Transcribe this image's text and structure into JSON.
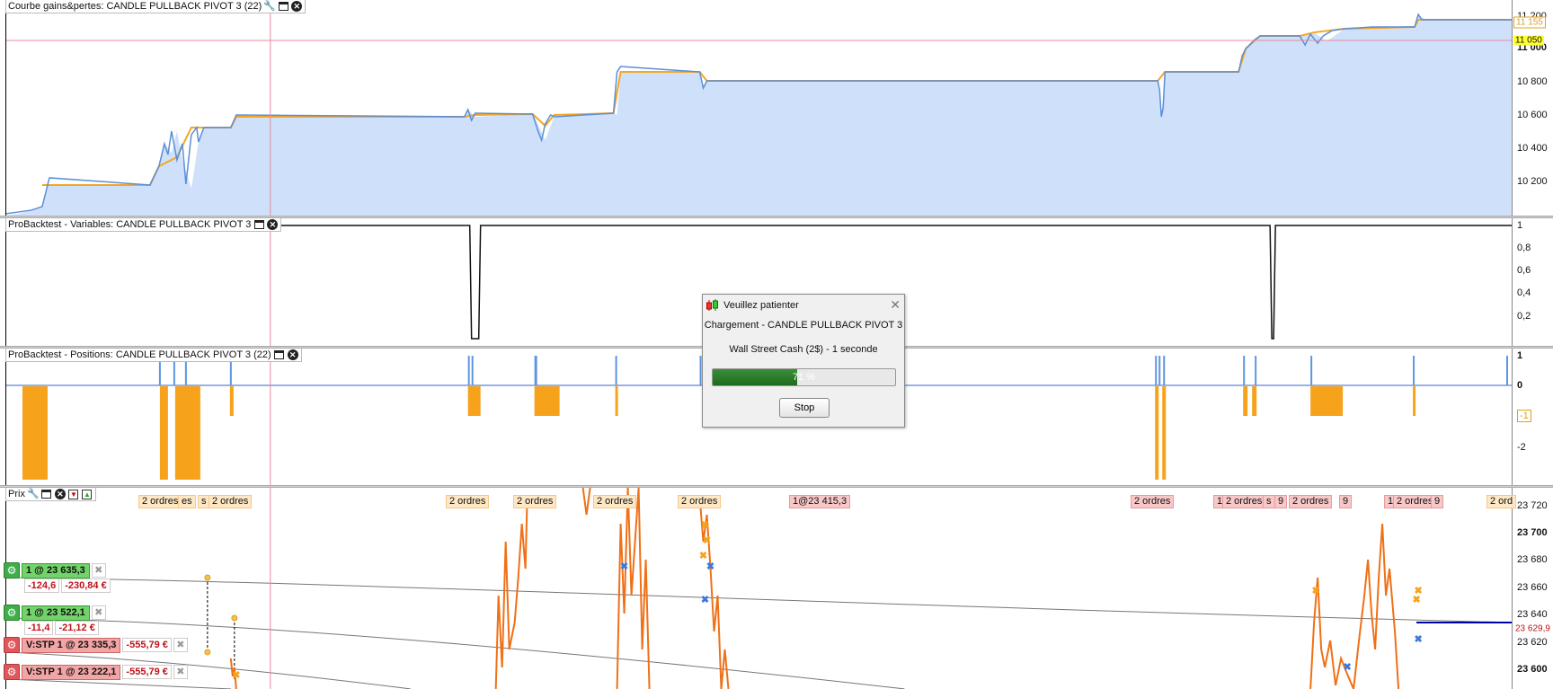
{
  "panes": {
    "equity": {
      "title": "Courbe gains&pertes: CANDLE PULLBACK PIVOT 3 (22)",
      "ticks": [
        "11 200",
        "11 000",
        "10 800",
        "10 600",
        "10 400",
        "10 200"
      ],
      "tag_current": "11 155",
      "tag_cross": "11 050"
    },
    "variables": {
      "title": "ProBacktest - Variables: CANDLE PULLBACK PIVOT 3",
      "ticks": [
        "1",
        "0,8",
        "0,6",
        "0,4",
        "0,2"
      ]
    },
    "positions": {
      "title": "ProBacktest - Positions: CANDLE PULLBACK PIVOT 3 (22)",
      "ticks": [
        "1",
        "0",
        "-1",
        "-2"
      ]
    },
    "price": {
      "title": "Prix",
      "ticks": [
        "23 720",
        "23 700",
        "23 680",
        "23 660",
        "23 640",
        "23 620",
        "23 600"
      ],
      "tag_current": "23 629,9",
      "order_tags": [
        "2 ordres",
        "es",
        "s",
        "2 ordres",
        "2 ordres",
        "2 ordres",
        "2 ordres",
        "2 ordres",
        "1@23 415,3",
        "2 ordres",
        "1",
        "2 ordres",
        "s",
        "9",
        "2 ordres",
        "9",
        "1",
        "2 ordres",
        "9",
        "2 ord"
      ],
      "positions": [
        {
          "qty": "1 @ 23 635,3",
          "pts": "-124,6",
          "eur": "-230,84 €"
        },
        {
          "qty": "1 @ 23 522,1",
          "pts": "-11,4",
          "eur": "-21,12 €"
        }
      ],
      "stops": [
        {
          "label": "V:STP  1 @ 23 335,3",
          "eur": "-555,79 €"
        },
        {
          "label": "V:STP  1 @ 23 222,1",
          "eur": "-555,79 €"
        }
      ]
    }
  },
  "dialog": {
    "title": "Veuillez patienter",
    "line1": "Chargement - CANDLE PULLBACK PIVOT 3",
    "line2": "Wall Street Cash (2$) - 1 seconde",
    "progress": 0.71,
    "progress_label": "71 %",
    "stop_label": "Stop"
  },
  "icons": [
    "wrench-icon",
    "window-icon",
    "close-icon",
    "gear-icon",
    "close-x-icon",
    "download-icon",
    "upload-icon",
    "candle-icon"
  ],
  "colors": {
    "equity_fill": "#cfe0fa",
    "equity_line": "#5a8fd8",
    "equity_line2": "#f5a623",
    "position_bar": "#f7a21b",
    "position_up": "#5d95e0",
    "price_line": "#f07016",
    "crosshair": "#e88aa0"
  }
}
